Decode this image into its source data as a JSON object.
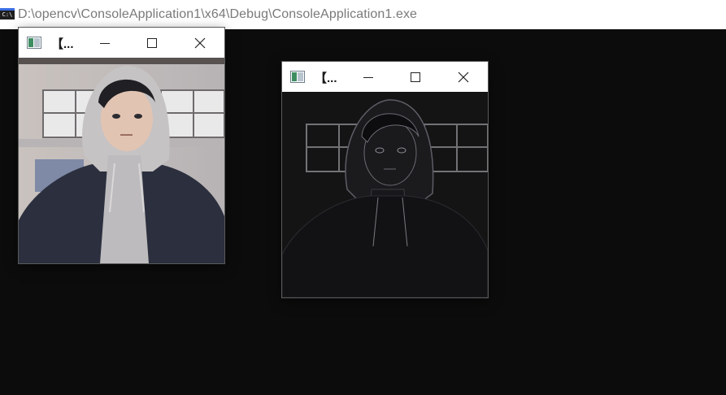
{
  "console": {
    "icon_label": "C:\\",
    "title": "D:\\opencv\\ConsoleApplication1\\x64\\Debug\\ConsoleApplication1.exe"
  },
  "windows": [
    {
      "title": "【...",
      "image": "original-photo",
      "controls": [
        "minimize",
        "maximize",
        "close"
      ]
    },
    {
      "title": "【...",
      "image": "processed-dark-photo",
      "controls": [
        "minimize",
        "maximize",
        "close"
      ]
    }
  ],
  "colors": {
    "console_background": "#0c0c0c",
    "titlebar_background": "#ffffff",
    "console_title_text": "#7a7a7a"
  },
  "icons": {
    "console": "console-app-icon",
    "window": "image-window-icon",
    "minimize": "minimize-icon",
    "maximize": "maximize-icon",
    "close": "close-icon"
  }
}
